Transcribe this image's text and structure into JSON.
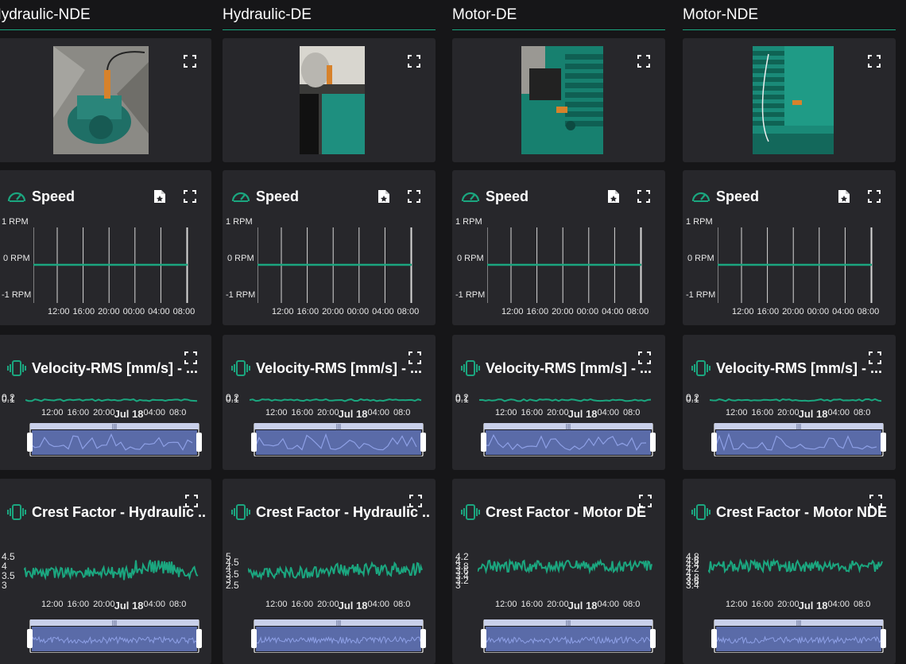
{
  "columns": [
    {
      "id": "hydraulic-nde",
      "header": "Hydraulic-NDE",
      "header_offset": -4,
      "photo_desc": "pump with sensor",
      "speed": {
        "title": "Speed",
        "y_ticks": [
          "1 RPM",
          "0 RPM",
          "-1 RPM"
        ],
        "x_ticks": [
          "12:00",
          "16:00",
          "20:00",
          "00:00",
          "04:00",
          "08:00"
        ]
      },
      "velocity": {
        "title": "Velocity-RMS [mm/s] - ...",
        "y_ticks": [
          "0.2",
          "0.1"
        ],
        "x_ticks": [
          "12:00",
          "16:00",
          "20:00",
          "Jul 18",
          "04:00",
          "08:0"
        ]
      },
      "crest": {
        "title": "Crest Factor - Hydraulic ...",
        "y_ticks": [
          "4.5",
          "4",
          "3.5",
          "3"
        ],
        "x_ticks": [
          "12:00",
          "16:00",
          "20:00",
          "Jul 18",
          "04:00",
          "08:0"
        ]
      }
    },
    {
      "id": "hydraulic-de",
      "header": "Hydraulic-DE",
      "photo_desc": "coupling with sensor",
      "speed": {
        "title": "Speed",
        "y_ticks": [
          "1 RPM",
          "0 RPM",
          "-1 RPM"
        ],
        "x_ticks": [
          "12:00",
          "16:00",
          "20:00",
          "00:00",
          "04:00",
          "08:00"
        ]
      },
      "velocity": {
        "title": "Velocity-RMS [mm/s] - ...",
        "y_ticks": [
          "0.2",
          "0.1"
        ],
        "x_ticks": [
          "12:00",
          "16:00",
          "20:00",
          "Jul 18",
          "04:00",
          "08:0"
        ]
      },
      "crest": {
        "title": "Crest Factor - Hydraulic ...",
        "y_ticks": [
          "5",
          "4.5",
          "4",
          "3.5",
          "3",
          "2.5"
        ],
        "x_ticks": [
          "12:00",
          "16:00",
          "20:00",
          "Jul 18",
          "04:00",
          "08:0"
        ]
      }
    },
    {
      "id": "motor-de",
      "header": "Motor-DE",
      "photo_desc": "motor drive end",
      "speed": {
        "title": "Speed",
        "y_ticks": [
          "1 RPM",
          "0 RPM",
          "-1 RPM"
        ],
        "x_ticks": [
          "12:00",
          "16:00",
          "20:00",
          "00:00",
          "04:00",
          "08:00"
        ]
      },
      "velocity": {
        "title": "Velocity-RMS [mm/s] - ...",
        "y_ticks": [
          "0.2",
          "0.1"
        ],
        "x_ticks": [
          "12:00",
          "16:00",
          "20:00",
          "Jul 18",
          "04:00",
          "08:0"
        ]
      },
      "crest": {
        "title": "Crest Factor - Motor DE",
        "y_ticks": [
          "4.2",
          "4",
          "3.8",
          "3.6",
          "3.4",
          "3.2",
          "3"
        ],
        "x_ticks": [
          "12:00",
          "16:00",
          "20:00",
          "Jul 18",
          "04:00",
          "08:0"
        ]
      }
    },
    {
      "id": "motor-nde",
      "header": "Motor-NDE",
      "photo_desc": "motor non drive end",
      "speed": {
        "title": "Speed",
        "y_ticks": [
          "1 RPM",
          "0 RPM",
          "-1 RPM"
        ],
        "x_ticks": [
          "12:00",
          "16:00",
          "20:00",
          "00:00",
          "04:00",
          "08:00"
        ]
      },
      "velocity": {
        "title": "Velocity-RMS [mm/s] - ...",
        "y_ticks": [
          "0.2",
          "0.1"
        ],
        "x_ticks": [
          "12:00",
          "16:00",
          "20:00",
          "Jul 18",
          "04:00",
          "08:0"
        ]
      },
      "crest": {
        "title": "Crest Factor - Motor NDE",
        "y_ticks": [
          "4.8",
          "4.6",
          "4.4",
          "4.2",
          "4",
          "3.8",
          "3.6",
          "3.4"
        ],
        "x_ticks": [
          "12:00",
          "16:00",
          "20:00",
          "Jul 18",
          "04:00",
          "08:0"
        ]
      }
    }
  ],
  "colors": {
    "accent": "#1ba67f",
    "panel": "#27272b",
    "background": "#161618",
    "slider_fill": "#5a6ba8",
    "slider_line": "#8ea0e6"
  }
}
